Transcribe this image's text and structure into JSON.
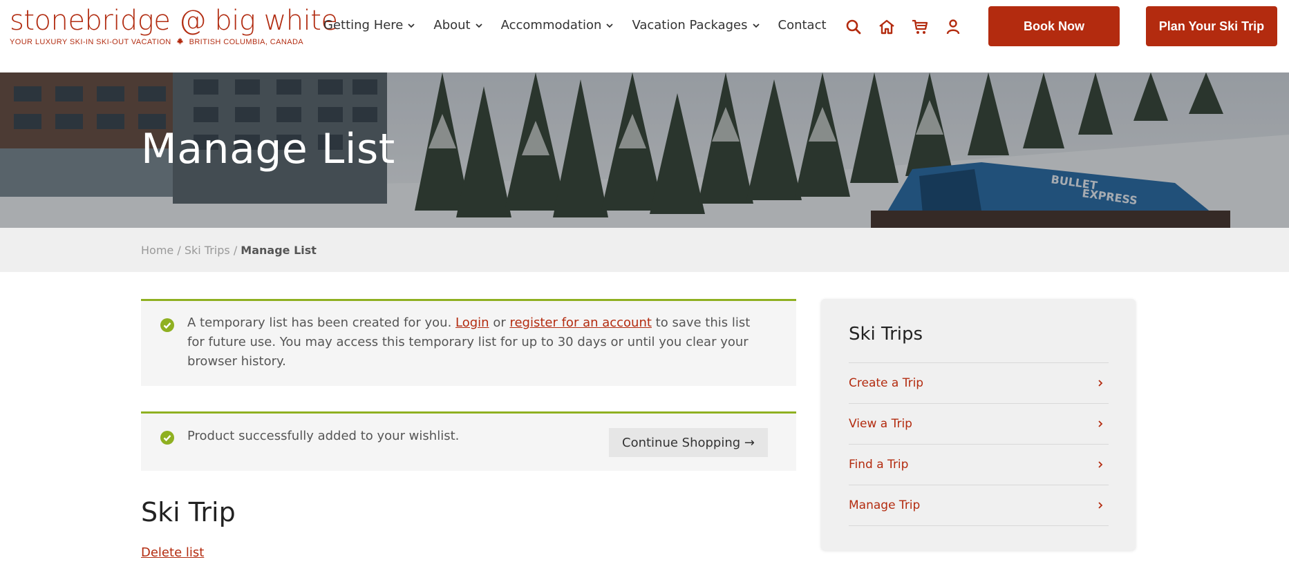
{
  "brand": {
    "name": "stonebridge @ big white",
    "tagline_left": "YOUR LUXURY SKI-IN SKI-OUT VACATION",
    "tagline_right": "BRITISH COLUMBIA, CANADA",
    "color": "#b32b0f"
  },
  "nav": {
    "items": [
      {
        "label": "Getting Here",
        "dropdown": true
      },
      {
        "label": "About",
        "dropdown": true
      },
      {
        "label": "Accommodation",
        "dropdown": true
      },
      {
        "label": "Vacation Packages",
        "dropdown": true
      },
      {
        "label": "Contact",
        "dropdown": false
      }
    ],
    "icons": [
      "search-icon",
      "home-icon",
      "cart-icon",
      "user-icon"
    ],
    "book_label": "Book Now",
    "plan_label": "Plan Your Ski Trip"
  },
  "hero": {
    "title": "Manage List",
    "sign_text_1": "BULLET",
    "sign_text_2": "EXPRESS"
  },
  "breadcrumb": {
    "items": [
      "Home",
      "Ski Trips"
    ],
    "separator": "/",
    "current": "Manage List"
  },
  "notices": {
    "temp": {
      "text_before": "A temporary list has been created for you. ",
      "login": "Login",
      "or": " or ",
      "register": "register for an account",
      "text_after": " to save this list for future use. You may access this temporary list for up to 30 days or until you clear your browser history."
    },
    "added": {
      "text": "Product successfully added to your wishlist.",
      "button": "Continue Shopping →"
    },
    "accent": "#8fb021"
  },
  "list": {
    "title": "Ski Trip",
    "delete_label": "Delete list"
  },
  "sidebar": {
    "title": "Ski Trips",
    "items": [
      "Create a Trip",
      "View a Trip",
      "Find a Trip",
      "Manage Trip"
    ]
  }
}
